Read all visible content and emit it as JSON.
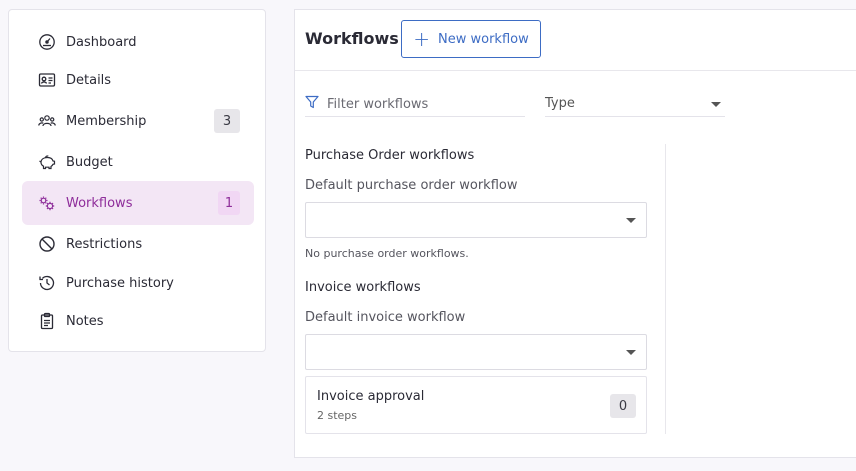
{
  "sidebar": {
    "items": [
      {
        "label": "Dashboard",
        "icon": "dashboard-gauge-icon"
      },
      {
        "label": "Details",
        "icon": "id-card-icon"
      },
      {
        "label": "Membership",
        "icon": "users-icon",
        "badge": "3"
      },
      {
        "label": "Budget",
        "icon": "piggy-bank-icon"
      },
      {
        "label": "Workflows",
        "icon": "workflow-gears-icon",
        "badge": "1",
        "active": true
      },
      {
        "label": "Restrictions",
        "icon": "prohibited-icon"
      },
      {
        "label": "Purchase history",
        "icon": "history-icon"
      },
      {
        "label": "Notes",
        "icon": "clipboard-icon"
      }
    ]
  },
  "header": {
    "title": "Workflows",
    "new_button_label": "New workflow"
  },
  "filter": {
    "placeholder": "Filter workflows",
    "type_label": "Type"
  },
  "purchase_order": {
    "title": "Purchase Order workflows",
    "default_label": "Default purchase order workflow",
    "default_value": "",
    "empty_text": "No purchase order workflows."
  },
  "invoice": {
    "title": "Invoice workflows",
    "default_label": "Default invoice workflow",
    "default_value": "",
    "workflows": [
      {
        "name": "Invoice approval",
        "steps": "2 steps",
        "count": "0"
      }
    ]
  },
  "colors": {
    "accent_purple": "#8e2d9a",
    "active_bg": "#f3e6f5",
    "link_blue": "#3d6cc4"
  }
}
